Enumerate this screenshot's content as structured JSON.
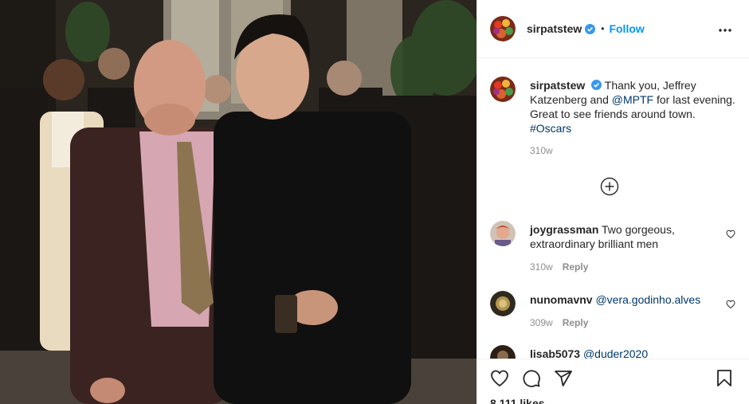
{
  "post": {
    "username": "sirpatstew",
    "separator": "•",
    "follow_label": "Follow"
  },
  "caption": {
    "username": "sirpatstew",
    "text_1": "Thank you, Jeffrey Katzenberg and",
    "mention": "@MPTF",
    "text_2": "for last evening. Great to see friends around town.",
    "hashtag": "#Oscars",
    "time": "310w"
  },
  "comments": [
    {
      "username": "joygrassman",
      "text": "Two gorgeous, extraordinary brilliant men",
      "time": "310w",
      "reply": "Reply"
    },
    {
      "username": "nunomavnv",
      "text": "@vera.godinho.alves",
      "time": "309w",
      "reply": "Reply"
    },
    {
      "username": "lisab5073",
      "text": "@duder2020"
    }
  ],
  "likes": "8,111 likes",
  "icons": {
    "more": "more-options-icon",
    "verified": "verified-badge-icon",
    "load_more": "plus-circle-icon",
    "like": "heart-icon",
    "comment": "comment-icon",
    "share": "share-icon",
    "save": "bookmark-icon"
  },
  "colors": {
    "link": "#0095f6",
    "mention": "#00376b",
    "muted": "#8e8e8e"
  }
}
